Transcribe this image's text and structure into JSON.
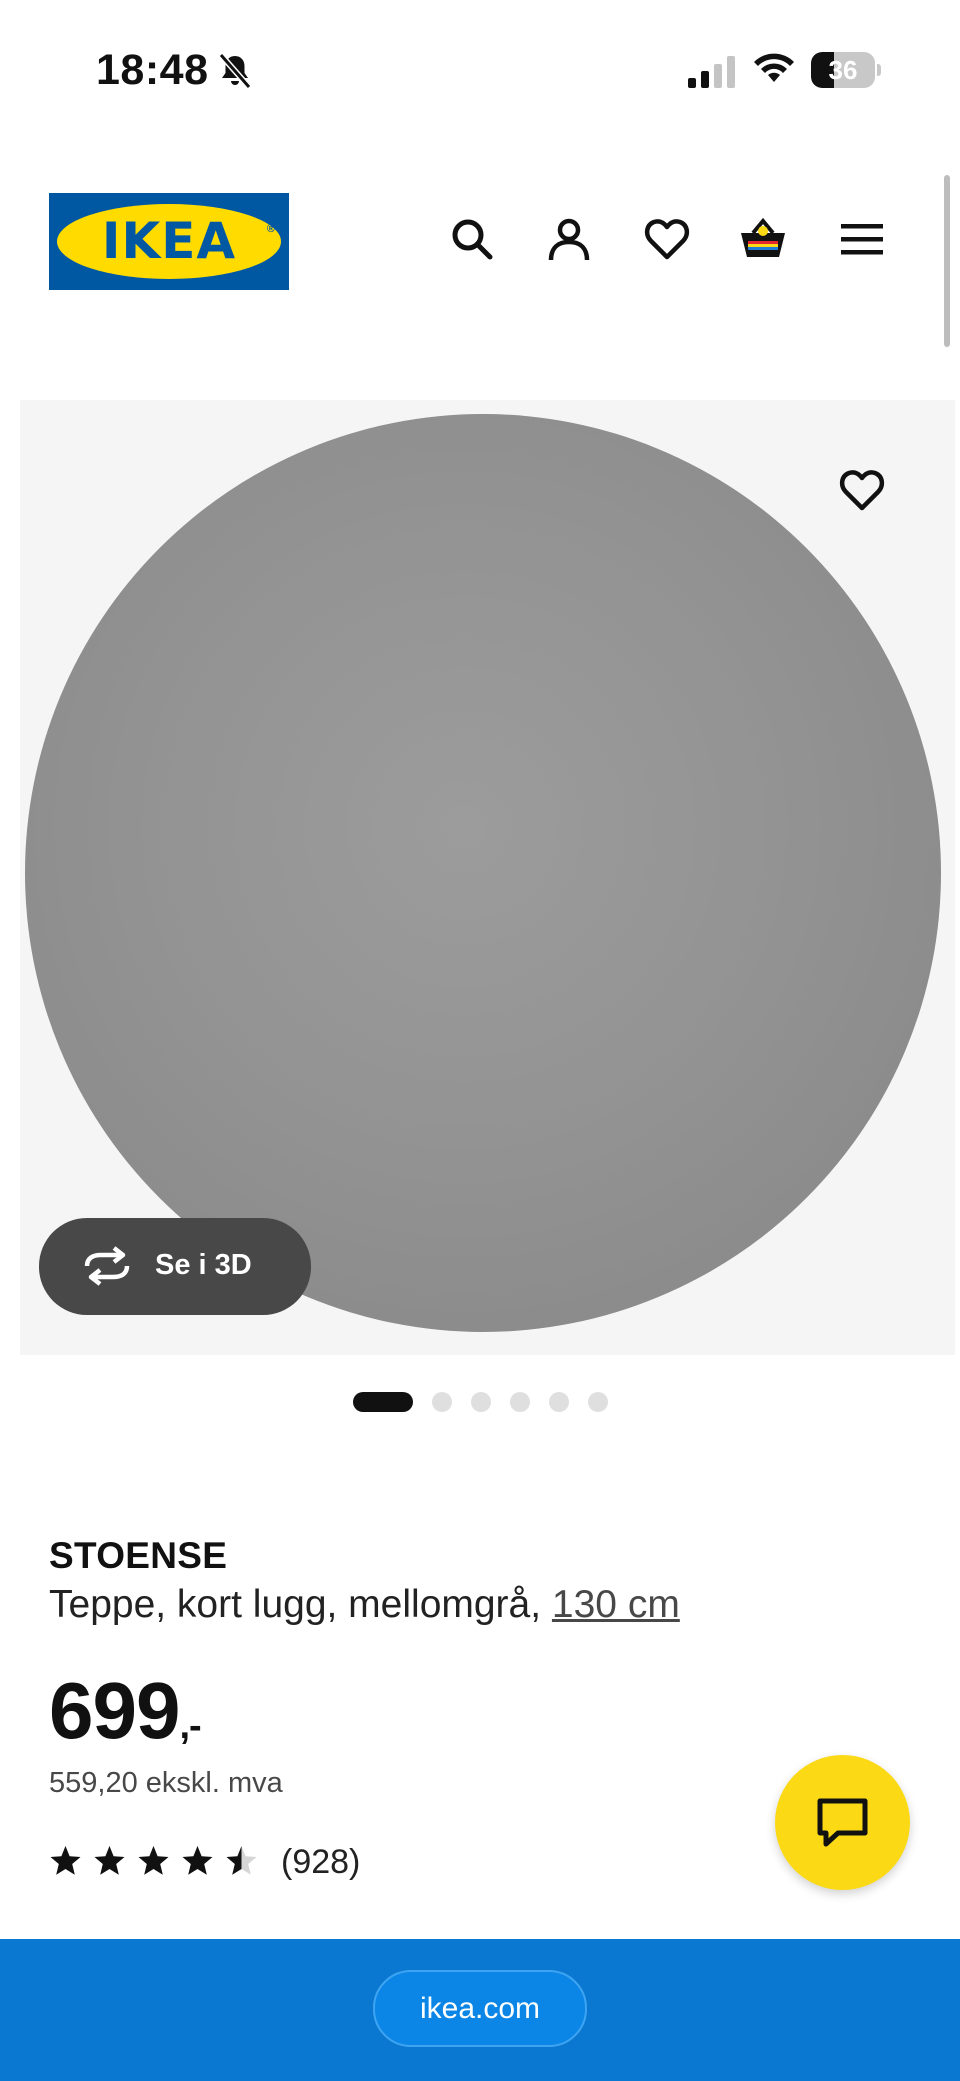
{
  "status_bar": {
    "time": "18:48",
    "silent_icon": "bell-slash-icon",
    "signal_icon": "cellular-signal-icon",
    "wifi_icon": "wifi-icon",
    "battery_level": "36",
    "battery_fraction": 0.36
  },
  "header": {
    "logo_text": "IKEA",
    "logo_colors": {
      "background": "#0058a3",
      "ellipse": "#ffdb00"
    },
    "icons": [
      "search-icon",
      "account-icon",
      "wishlist-heart-icon",
      "shopping-basket-icon",
      "menu-icon"
    ]
  },
  "gallery": {
    "view_3d_label": "Se i 3D",
    "dot_count": 6,
    "active_index": 0
  },
  "product": {
    "name": "STOENSE",
    "description": "Teppe, kort lugg, mellomgrå,",
    "size": "130 cm",
    "price": "699",
    "price_suffix": ",-",
    "price_ex_vat": "559,20 ekskl. mva",
    "rating": 4.5,
    "review_count": "(928)"
  },
  "bottom_bar": {
    "url": "ikea.com"
  },
  "colors": {
    "accent_yellow": "#fbd914",
    "bottom_blue": "#0a78d0",
    "text": "#111111"
  }
}
